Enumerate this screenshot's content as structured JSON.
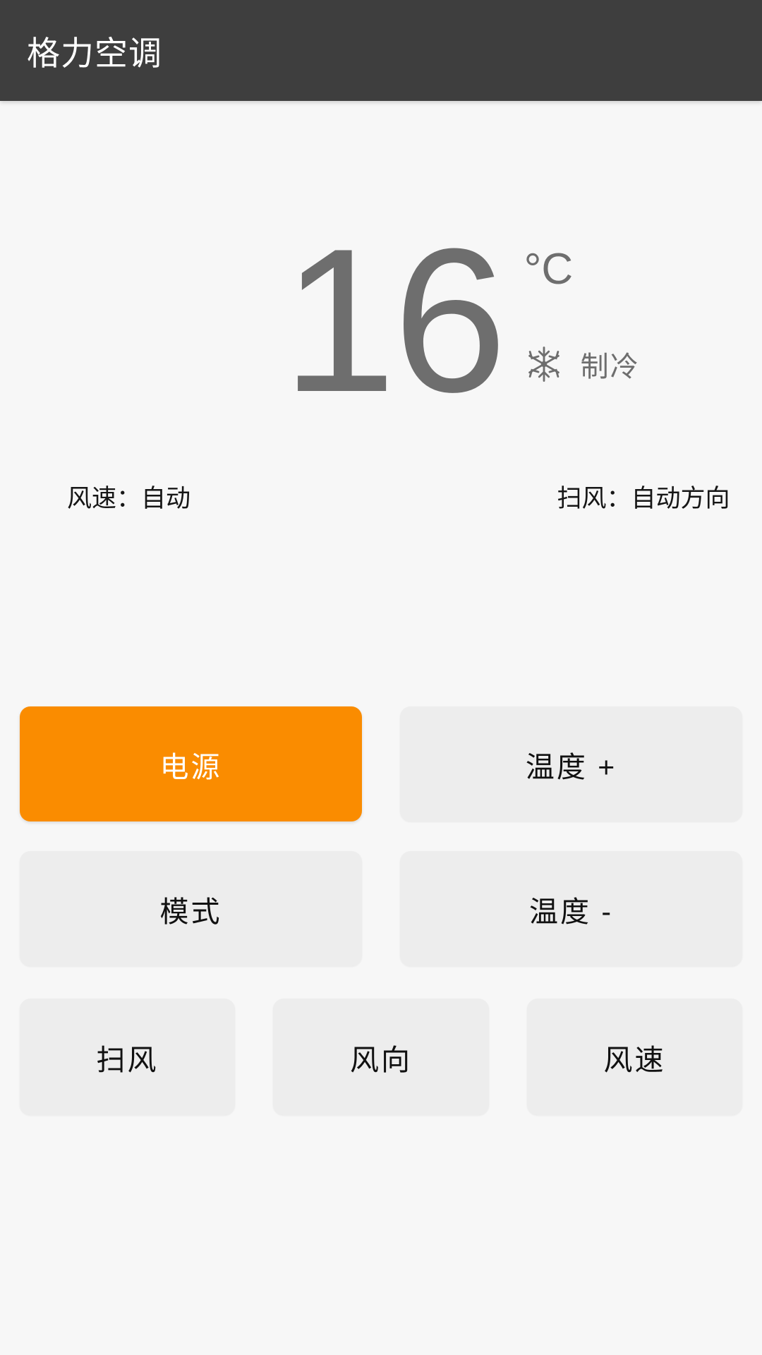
{
  "app": {
    "title": "格力空调"
  },
  "display": {
    "temperature": "16",
    "unit": "°C",
    "mode_icon": "snowflake-icon",
    "mode_label": "制冷"
  },
  "status": {
    "fan_speed": "风速：自动",
    "swing": "扫风：自动方向"
  },
  "buttons": {
    "power": "电源",
    "temp_up": "温度 +",
    "mode": "模式",
    "temp_down": "温度 -",
    "swing": "扫风",
    "direction": "风向",
    "fan_speed": "风速"
  },
  "colors": {
    "appbar_bg": "#3E3E3E",
    "page_bg": "#F7F7F7",
    "accent": "#FA8C00",
    "button_bg": "#EDEDED",
    "temp_text": "#6E6E6E",
    "button_text": "#111111",
    "primary_button_text": "#FFFFFF"
  }
}
